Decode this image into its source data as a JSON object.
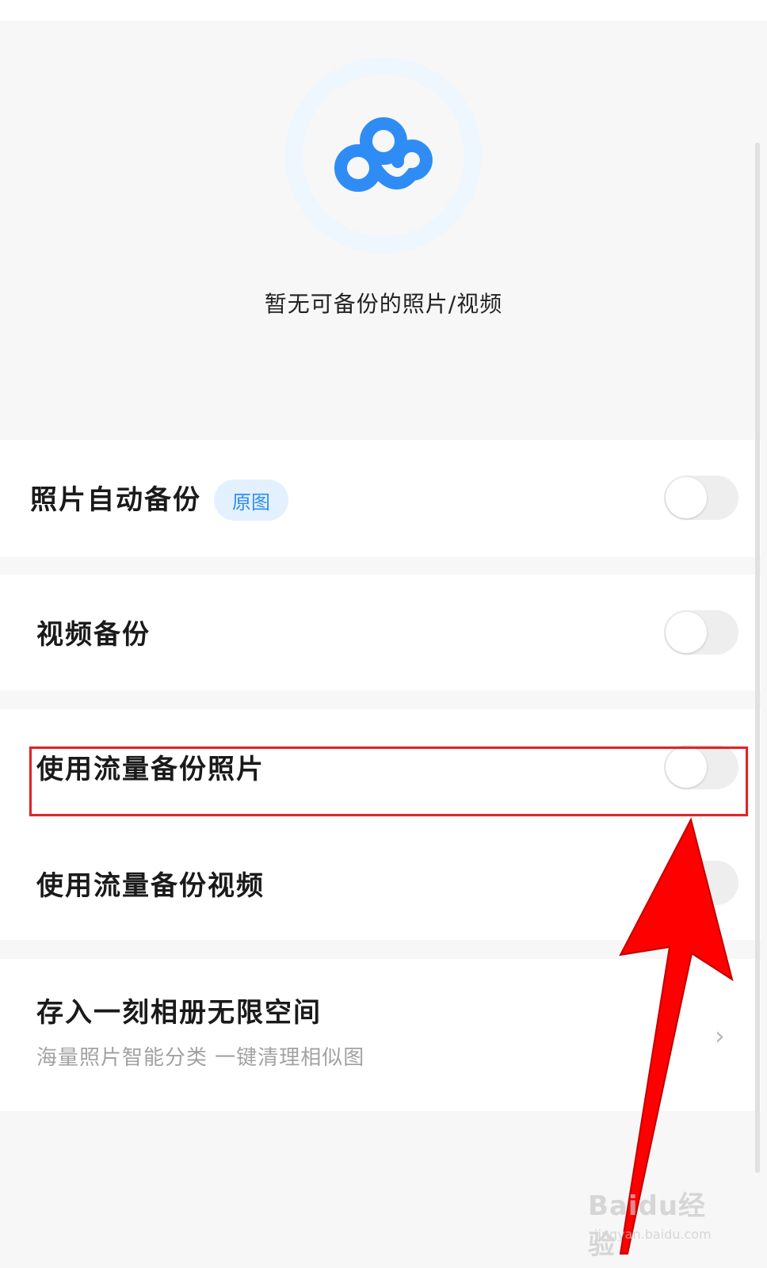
{
  "empty_state": {
    "message": "暂无可备份的照片/视频",
    "icon": "baidu-netdisk-logo-icon"
  },
  "settings": {
    "photo_auto_backup": {
      "label": "照片自动备份",
      "badge": "原图",
      "enabled": false
    },
    "video_backup": {
      "label": "视频备份",
      "enabled": false
    },
    "mobile_data_photo_backup": {
      "label": "使用流量备份照片",
      "enabled": false
    },
    "mobile_data_video_backup": {
      "label": "使用流量备份视频",
      "enabled": false
    },
    "one_moment_album": {
      "label": "存入一刻相册无限空间",
      "subtitle": "海量照片智能分类 一键清理相似图",
      "icon": "chevron-right-icon"
    }
  },
  "watermark": {
    "brand": "Baidu经验",
    "url": "jingyan.baidu.com"
  },
  "colors": {
    "accent": "#2f8cf5",
    "badge_bg": "#e3f1ff",
    "annotation_red": "#e1232a",
    "arrow_red": "#ff0000"
  }
}
